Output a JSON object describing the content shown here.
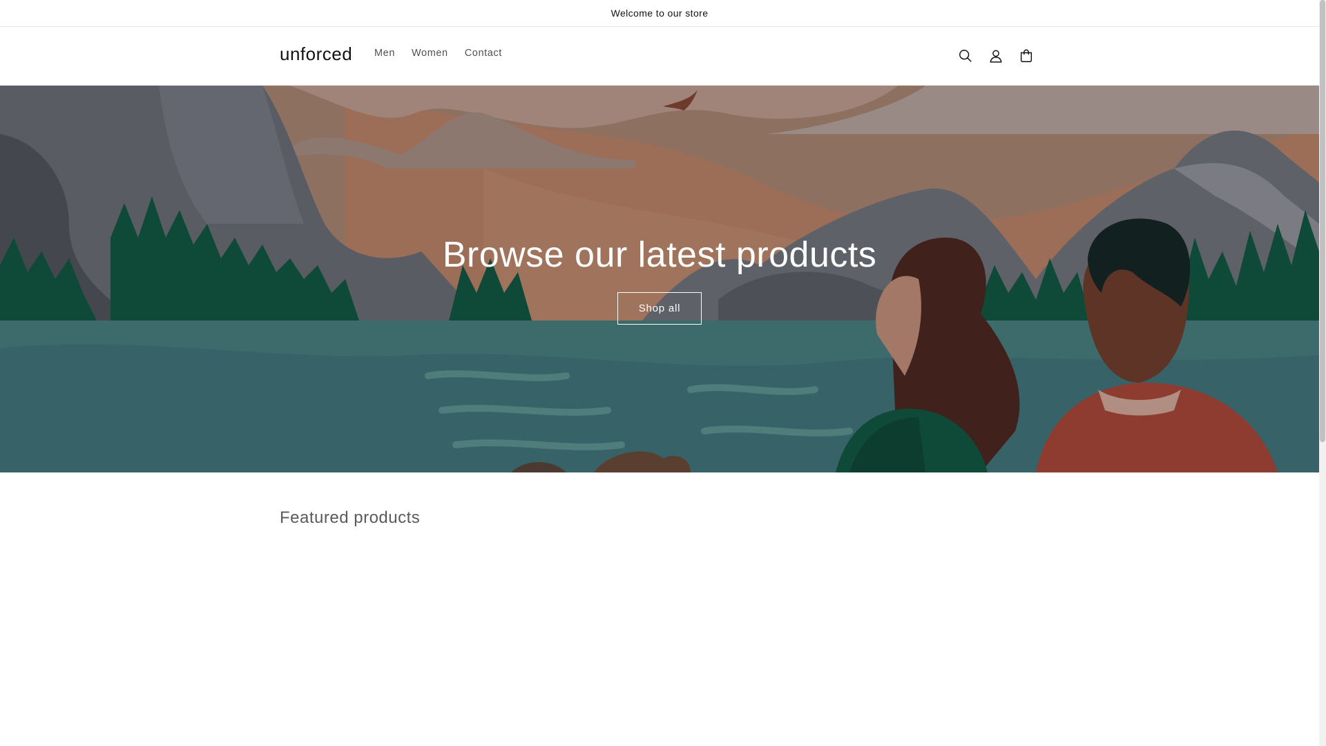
{
  "announcement": {
    "text": "Welcome to our store"
  },
  "header": {
    "logo": "unforced",
    "nav": [
      {
        "label": "Men"
      },
      {
        "label": "Women"
      },
      {
        "label": "Contact"
      }
    ],
    "icons": [
      "search-icon",
      "account-icon",
      "cart-icon"
    ]
  },
  "hero": {
    "title": "Browse our latest products",
    "button_label": "Shop all"
  },
  "featured": {
    "title": "Featured products"
  },
  "colors": {
    "sky": "#8e7060",
    "mountain_gray": "#5f6067",
    "water": "#3d6b6b",
    "tree_green": "#0f4a38",
    "text": "#121212"
  }
}
